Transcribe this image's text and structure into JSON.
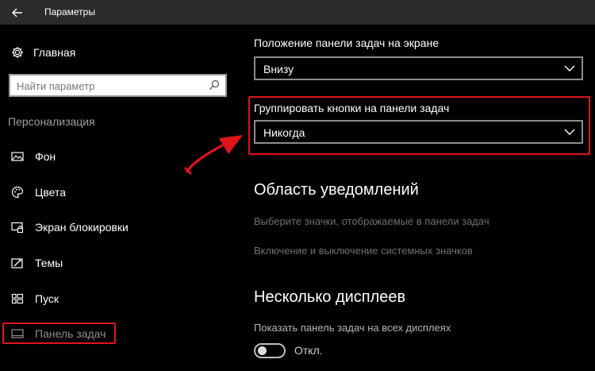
{
  "window": {
    "title": "Параметры"
  },
  "sidebar": {
    "home_label": "Главная",
    "search_placeholder": "Найти параметр",
    "section": "Персонализация",
    "items": [
      {
        "label": "Фон",
        "icon": "picture-icon"
      },
      {
        "label": "Цвета",
        "icon": "palette-icon"
      },
      {
        "label": "Экран блокировки",
        "icon": "lock-screen-icon"
      },
      {
        "label": "Темы",
        "icon": "themes-icon"
      },
      {
        "label": "Пуск",
        "icon": "start-icon"
      },
      {
        "label": "Панель задач",
        "icon": "taskbar-icon",
        "active": true
      }
    ]
  },
  "main": {
    "position_label": "Положение панели задач на экране",
    "position_value": "Внизу",
    "group_label": "Группировать кнопки на панели задач",
    "group_value": "Никогда",
    "notifications_heading": "Область уведомлений",
    "notifications_link_1": "Выберите значки, отображаемые в панели задач",
    "notifications_link_2": "Включение и выключение системных значков",
    "displays_heading": "Несколько дисплеев",
    "displays_label": "Показать панель задач на всех дисплеях",
    "displays_toggle_state": "Откл.",
    "displays_toggle_on": false
  },
  "colors": {
    "highlight": "#e0141b",
    "titlebar": "#2b2b2b",
    "background": "#000000"
  }
}
